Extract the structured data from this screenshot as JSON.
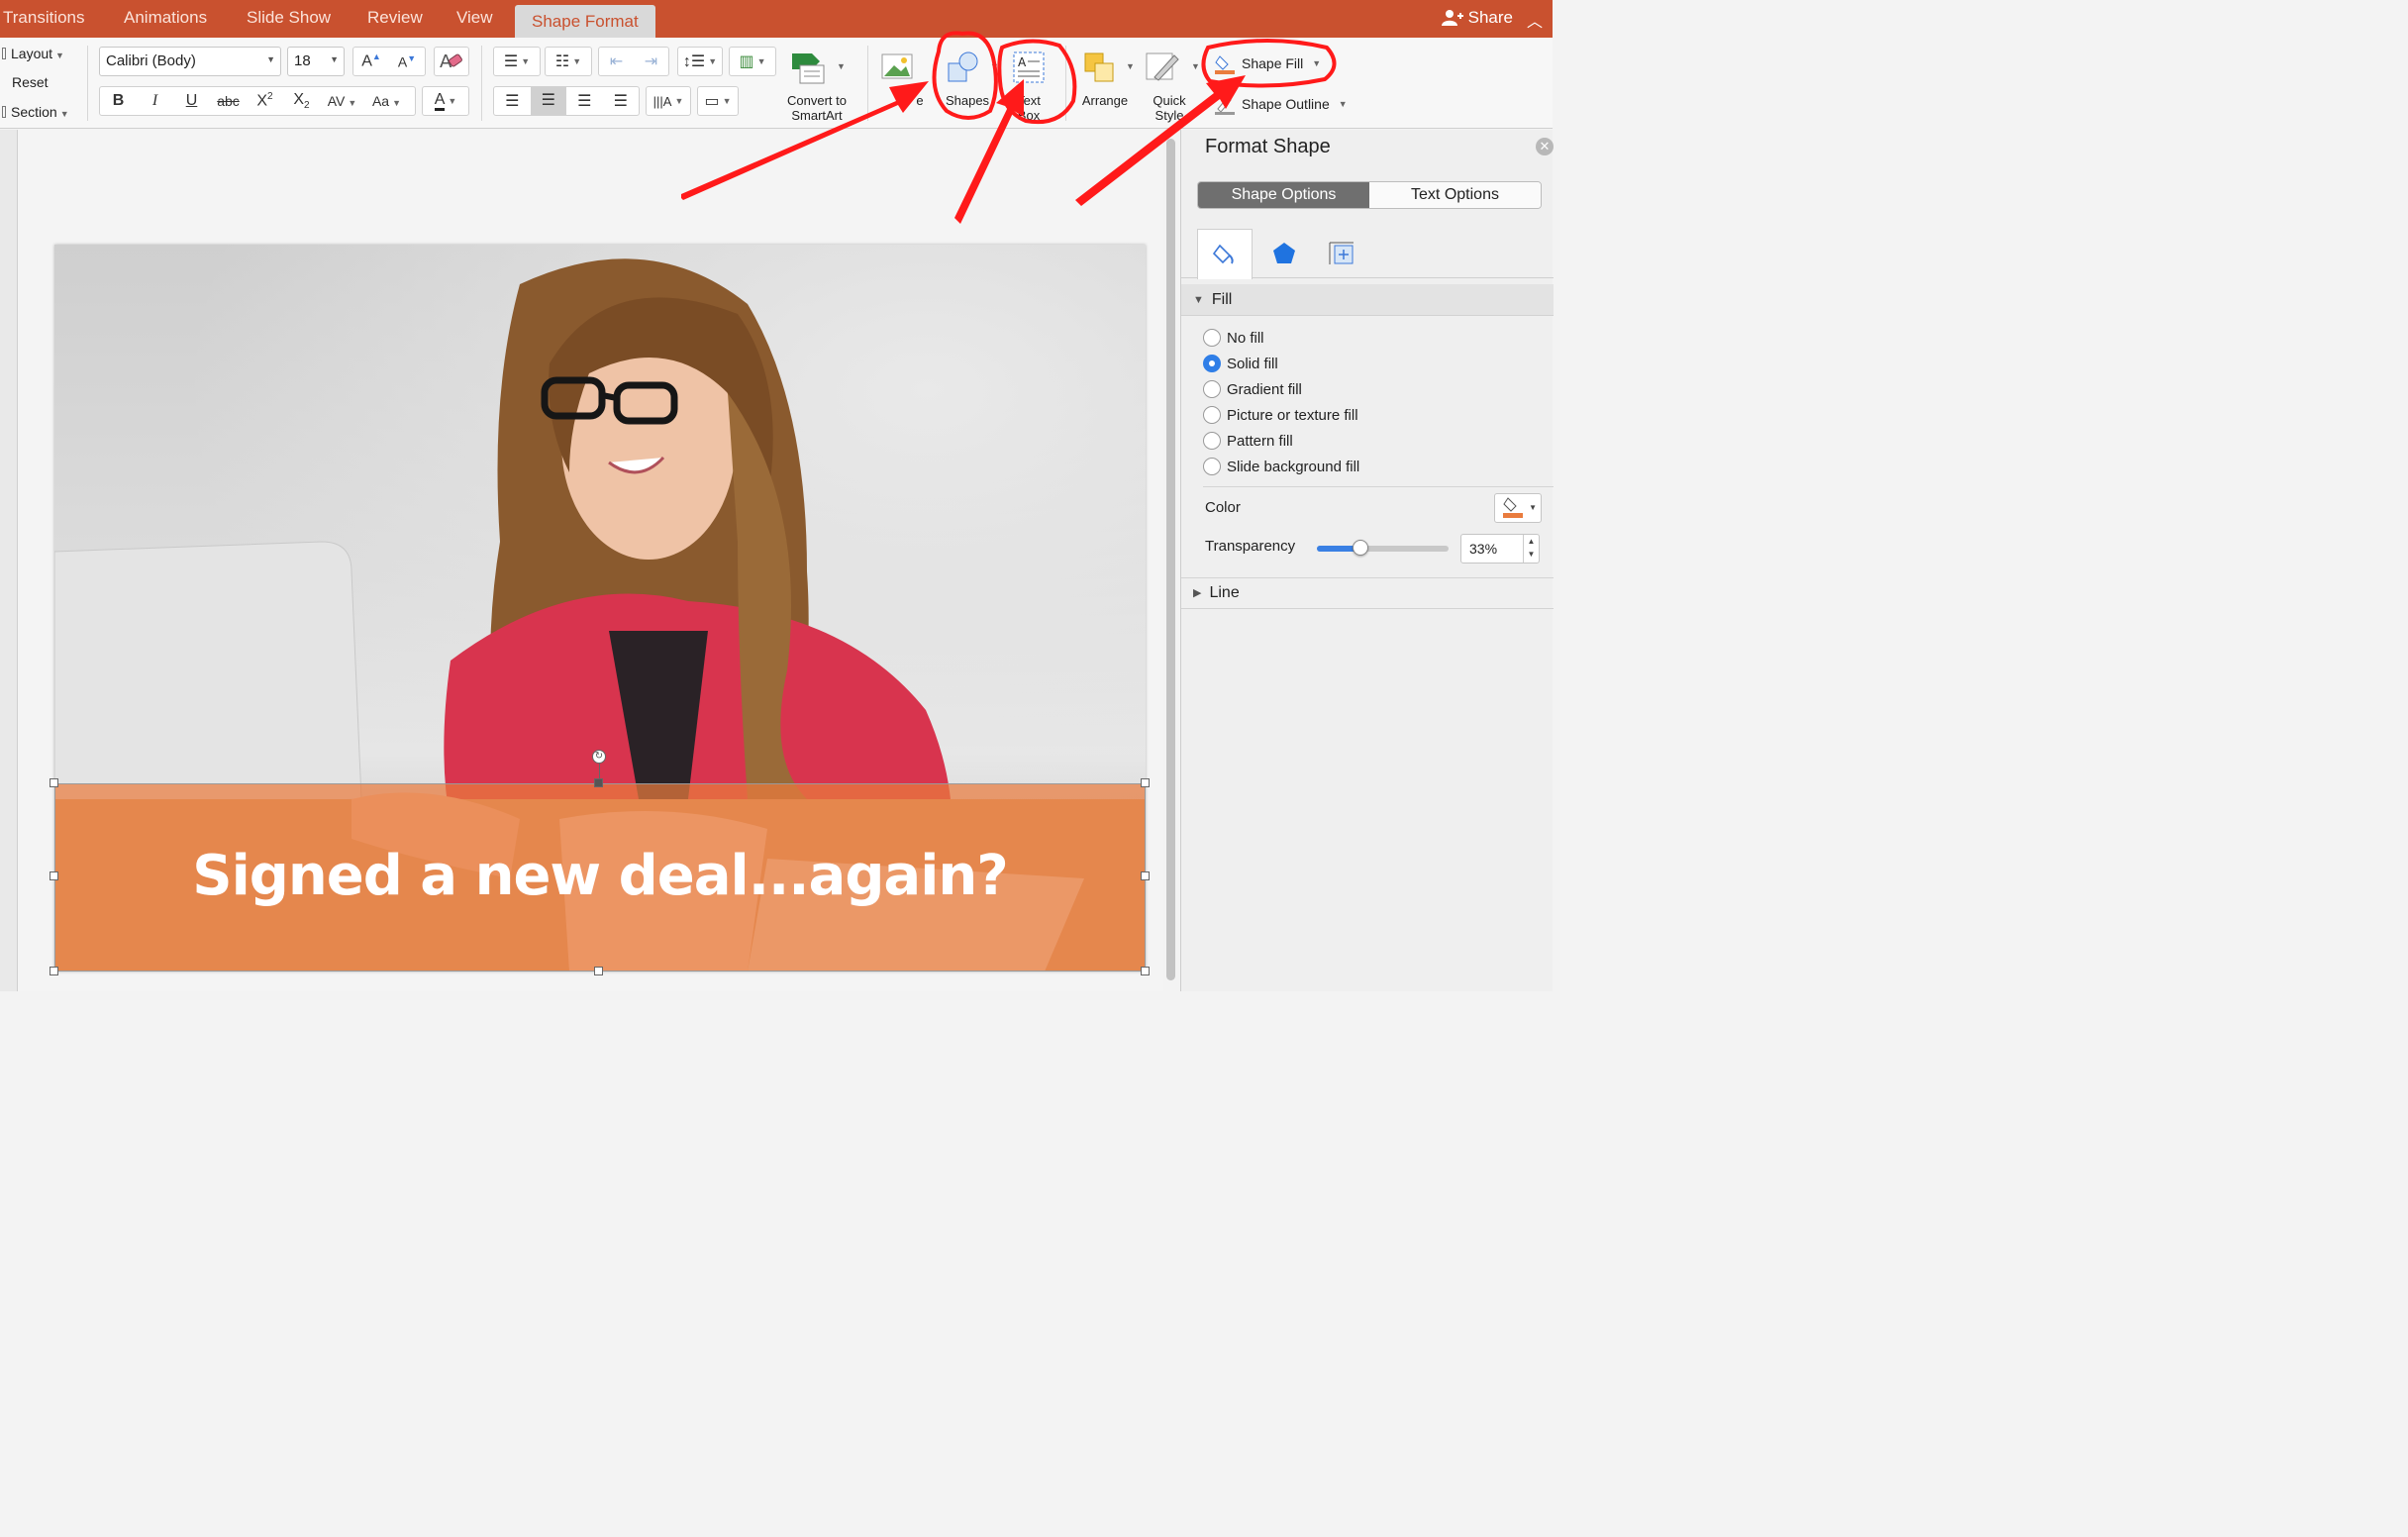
{
  "tabs": [
    {
      "label": "Transitions"
    },
    {
      "label": "Animations"
    },
    {
      "label": "Slide Show"
    },
    {
      "label": "Review"
    },
    {
      "label": "View"
    },
    {
      "label": "Shape Format",
      "active": true
    }
  ],
  "share_label": "Share",
  "ribbon": {
    "slides_group": {
      "layout": "Layout",
      "reset": "Reset",
      "section": "Section"
    },
    "font_name": "Calibri (Body)",
    "font_size": "18",
    "strike_label": "abc",
    "convert_label_1": "Convert to",
    "convert_label_2": "SmartArt",
    "picture_label": "e",
    "shapes_label": "Shapes",
    "textbox_label_1": "Text",
    "textbox_label_2": "Box",
    "arrange_label": "Arrange",
    "quick_label_1": "Quick",
    "quick_label_2": "Style",
    "shape_fill_label": "Shape Fill",
    "shape_outline_label": "Shape Outline"
  },
  "slide": {
    "headline": "Signed a new deal...again?"
  },
  "pane": {
    "title": "Format Shape",
    "tabs": [
      "Shape Options",
      "Text Options"
    ],
    "fill_section": "Fill",
    "fill_options": [
      {
        "label": "No fill",
        "selected": false
      },
      {
        "label": "Solid fill",
        "selected": true
      },
      {
        "label": "Gradient fill",
        "selected": false
      },
      {
        "label": "Picture or texture fill",
        "selected": false
      },
      {
        "label": "Pattern fill",
        "selected": false
      },
      {
        "label": "Slide background fill",
        "selected": false
      }
    ],
    "color_label": "Color",
    "transparency_label": "Transparency",
    "transparency_value": "33%",
    "transparency_fraction": 0.33,
    "line_section": "Line"
  },
  "colors": {
    "accent": "#c9512f",
    "fill_orange": "#e97c3e",
    "annotation_red": "#ff1a1a",
    "selected_blue": "#2f7ee7"
  }
}
